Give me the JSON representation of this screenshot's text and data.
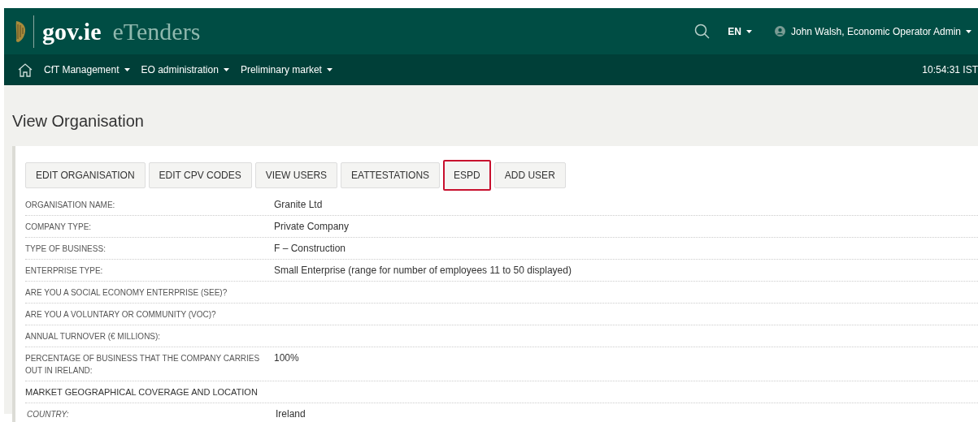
{
  "header": {
    "logo_text": "gov.ie",
    "app_name": "eTenders",
    "language": "EN",
    "user": "John Walsh, Economic Operator Admin"
  },
  "nav": {
    "items": [
      "CfT Management",
      "EO administration",
      "Preliminary market"
    ],
    "time": "10:54:31 IST"
  },
  "page_title": "View Organisation",
  "actions": [
    {
      "label": "EDIT ORGANISATION",
      "highlighted": false
    },
    {
      "label": "EDIT CPV CODES",
      "highlighted": false
    },
    {
      "label": "VIEW USERS",
      "highlighted": false
    },
    {
      "label": "EATTESTATIONS",
      "highlighted": false
    },
    {
      "label": "ESPD",
      "highlighted": true
    },
    {
      "label": "ADD USER",
      "highlighted": false
    }
  ],
  "details": [
    {
      "kind": "field",
      "label": "ORGANISATION NAME:",
      "value": "Granite Ltd"
    },
    {
      "kind": "field",
      "label": "COMPANY TYPE:",
      "value": "Private Company"
    },
    {
      "kind": "field",
      "label": "TYPE OF BUSINESS:",
      "value": "F – Construction"
    },
    {
      "kind": "field",
      "label": "ENTERPRISE TYPE:",
      "value": "Small Enterprise (range for number of employees 11 to 50 displayed)"
    },
    {
      "kind": "field",
      "label": "ARE YOU A SOCIAL ECONOMY ENTERPRISE (SEE)?"
    },
    {
      "kind": "field",
      "label": "ARE YOU A VOLUNTARY OR COMMUNITY (VOC)?"
    },
    {
      "kind": "field",
      "label": "ANNUAL TURNOVER (€ MILLIONS):"
    },
    {
      "kind": "field",
      "label": "PERCENTAGE OF BUSINESS THAT THE COMPANY CARRIES OUT IN IRELAND:",
      "value": "100%"
    },
    {
      "kind": "section",
      "label": "MARKET GEOGRAPHICAL COVERAGE AND LOCATION"
    },
    {
      "kind": "subfield",
      "label": "COUNTRY:",
      "value": "Ireland"
    }
  ]
}
